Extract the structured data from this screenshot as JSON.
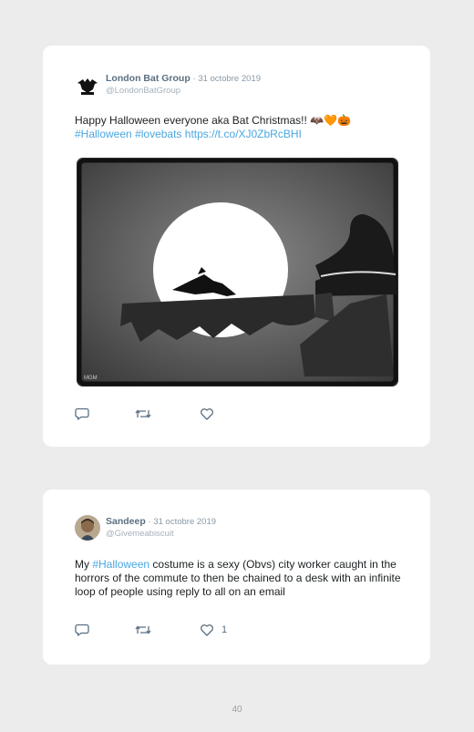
{
  "tweets": [
    {
      "name": "London Bat Group",
      "date": "· 31 octobre 2019",
      "handle": "@LondonBatGroup",
      "text_line1": "Happy Halloween everyone aka Bat Christmas!! 🦇🧡🎃",
      "hashtag1": "#Halloween",
      "hashtag2": "#lovebats",
      "url": "https://t.co/XJ0ZbRcBHI",
      "like_count": ""
    },
    {
      "name": "Sandeep",
      "date": "· 31 octobre 2019",
      "handle": "@Givemeabiscuit",
      "text_pre": "My ",
      "hashtag": "#Halloween",
      "text_post": " costume is a sexy (Obvs) city worker caught in the horrors of the commute to then be chained to a desk with an infinite loop of people using reply to all on an email",
      "like_count": "1"
    }
  ],
  "page_number": "40",
  "icons": [
    "reply-icon",
    "retweet-icon",
    "like-icon"
  ],
  "colors": {
    "background": "#ececec",
    "card": "#ffffff",
    "link": "#4aa6e0",
    "name": "#5a6f82",
    "muted": "#8899a6"
  }
}
